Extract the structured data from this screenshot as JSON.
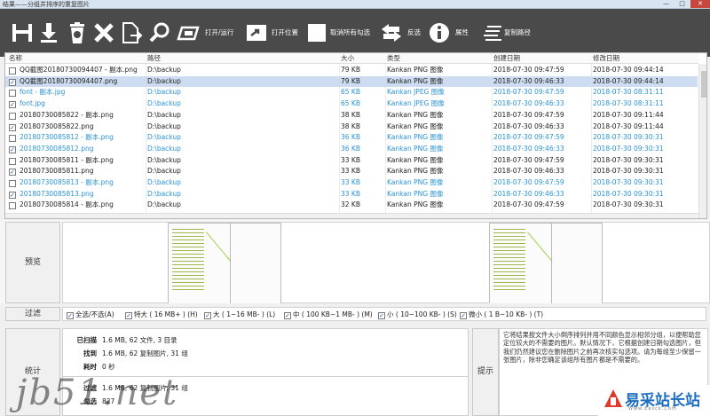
{
  "window": {
    "title": "结果——分组并排序的重复图片",
    "min": "—",
    "max": "□",
    "close": "✕"
  },
  "toolbar": {
    "open_run": "打开/运行",
    "open_location": "打开位置",
    "uncheck_all": "取消所有勾选",
    "invert": "反选",
    "properties": "属性",
    "copy_path": "复制路径"
  },
  "table": {
    "headers": [
      "名称",
      "路径",
      "大小",
      "类型",
      "创建日期",
      "修改日期"
    ],
    "rows": [
      {
        "checked": false,
        "selected": false,
        "blue": false,
        "name": "QQ截图20180730094407 - 副本.png",
        "path": "D:\\backup",
        "size": "79 KB",
        "type": "Kankan PNG 图像",
        "created": "2018-07-30 09:47:59",
        "modified": "2018-07-30 09:44:14"
      },
      {
        "checked": true,
        "selected": true,
        "blue": false,
        "name": "QQ截图20180730094407.png",
        "path": "D:\\backup",
        "size": "79 KB",
        "type": "Kankan PNG 图像",
        "created": "2018-07-30 09:46:33",
        "modified": "2018-07-30 09:44:14"
      },
      {
        "checked": false,
        "selected": false,
        "blue": true,
        "name": "font - 副本.jpg",
        "path": "D:\\backup",
        "size": "65 KB",
        "type": "Kankan JPEG 图像",
        "created": "2018-07-30 09:47:59",
        "modified": "2018-07-30 08:31:11"
      },
      {
        "checked": true,
        "selected": false,
        "blue": true,
        "name": "font.jpg",
        "path": "D:\\backup",
        "size": "65 KB",
        "type": "Kankan JPEG 图像",
        "created": "2018-07-30 09:46:33",
        "modified": "2018-07-30 08:31:11"
      },
      {
        "checked": false,
        "selected": false,
        "blue": false,
        "name": "20180730085822 - 副本.png",
        "path": "D:\\backup",
        "size": "38 KB",
        "type": "Kankan PNG 图像",
        "created": "2018-07-30 09:47:59",
        "modified": "2018-07-30 09:11:44"
      },
      {
        "checked": true,
        "selected": false,
        "blue": false,
        "name": "20180730085822.png",
        "path": "D:\\backup",
        "size": "38 KB",
        "type": "Kankan PNG 图像",
        "created": "2018-07-30 09:46:33",
        "modified": "2018-07-30 09:11:44"
      },
      {
        "checked": false,
        "selected": false,
        "blue": true,
        "name": "20180730085812 - 副本.png",
        "path": "D:\\backup",
        "size": "36 KB",
        "type": "Kankan PNG 图像",
        "created": "2018-07-30 09:47:59",
        "modified": "2018-07-30 09:30:31"
      },
      {
        "checked": true,
        "selected": false,
        "blue": true,
        "name": "20180730085812.png",
        "path": "D:\\backup",
        "size": "36 KB",
        "type": "Kankan PNG 图像",
        "created": "2018-07-30 09:46:33",
        "modified": "2018-07-30 09:30:31"
      },
      {
        "checked": false,
        "selected": false,
        "blue": false,
        "name": "20180730085811 - 副本.png",
        "path": "D:\\backup",
        "size": "33 KB",
        "type": "Kankan PNG 图像",
        "created": "2018-07-30 09:47:59",
        "modified": "2018-07-30 09:30:31"
      },
      {
        "checked": true,
        "selected": false,
        "blue": false,
        "name": "20180730085811.png",
        "path": "D:\\backup",
        "size": "33 KB",
        "type": "Kankan PNG 图像",
        "created": "2018-07-30 09:46:33",
        "modified": "2018-07-30 09:30:31"
      },
      {
        "checked": false,
        "selected": false,
        "blue": true,
        "name": "20180730085813 - 副本.png",
        "path": "D:\\backup",
        "size": "33 KB",
        "type": "Kankan PNG 图像",
        "created": "2018-07-30 09:47:59",
        "modified": "2018-07-30 09:30:31"
      },
      {
        "checked": true,
        "selected": false,
        "blue": true,
        "name": "20180730085813.png",
        "path": "D:\\backup",
        "size": "33 KB",
        "type": "Kankan PNG 图像",
        "created": "2018-07-30 09:46:33",
        "modified": "2018-07-30 09:30:31"
      },
      {
        "checked": false,
        "selected": false,
        "blue": false,
        "name": "20180730085814 - 副本.png",
        "path": "D:\\backup",
        "size": "32 KB",
        "type": "Kankan PNG 图像",
        "created": "2018-07-30 09:47:59",
        "modified": "2018-07-30 09:30:31"
      }
    ]
  },
  "preview": {
    "label": "预览"
  },
  "filter": {
    "label": "过滤",
    "items": [
      {
        "label": "全选/不选(A)",
        "checked": true
      },
      {
        "label": "特大 ( 16 MB+ ) (H)",
        "checked": true
      },
      {
        "label": "大 ( 1~16 MB- ) (L)",
        "checked": true
      },
      {
        "label": "中 ( 100 KB~1 MB- ) (M)",
        "checked": true
      },
      {
        "label": "小 ( 10~100 KB- ) (S)",
        "checked": true
      },
      {
        "label": "微小 ( 1 B~10 KB- ) (T)",
        "checked": true
      }
    ]
  },
  "stats": {
    "label": "统计",
    "scanned_label": "已扫描",
    "scanned_value": "1.6 MB, 62 文件, 3 目录",
    "found_label": "找到",
    "found_value": "1.6 MB, 62 复制图片, 31 组",
    "time_label": "耗时",
    "time_value": "0 秒",
    "filter_label": "过滤",
    "filter_value": "1.6 MB, 62 复制图片, 31 组",
    "checked_label": "勾选",
    "checked_value": "827"
  },
  "tips": {
    "label": "提示",
    "text": "它将结果按文件大小倒序排列并用不同颜色显示相邻分组，以便帮助您定位较大的不需要的图片。默认情况下，它根据创建日期勾选图片，但我们仍然建议您在删除图片之前再次核实勾选项。请为每组至少保留一张图片，除非您确定该组所有图片都是不需要的。"
  },
  "branding": {
    "watermark": "jb51.net",
    "logo_text": "易采站长站",
    "logo_sub": "Www.Easck.Com"
  }
}
